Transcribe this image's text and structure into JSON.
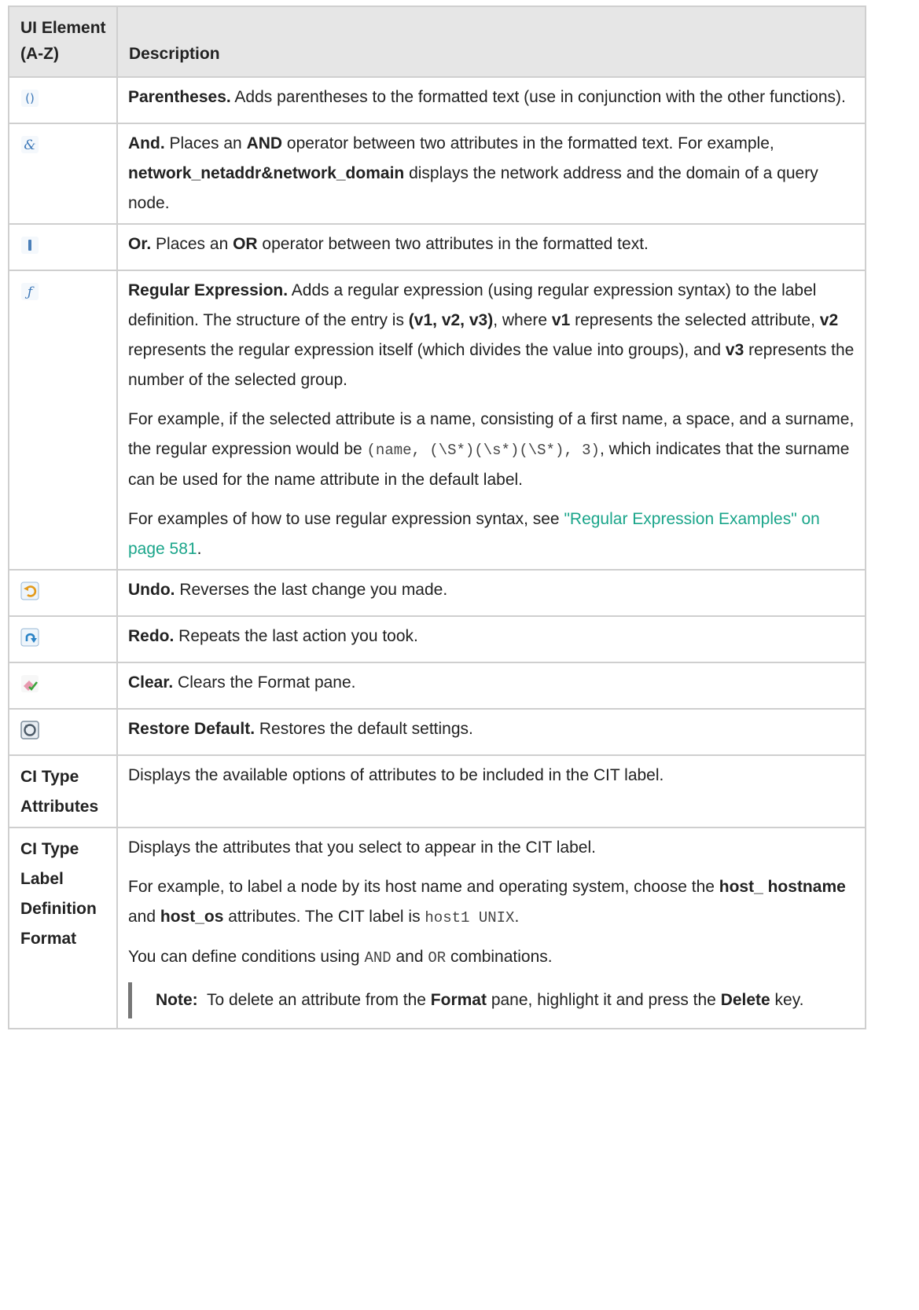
{
  "header": {
    "col1": "UI Element (A-Z)",
    "col2": "Description"
  },
  "rows": {
    "parentheses": {
      "icon": "parentheses-icon",
      "term": "Parentheses.",
      "text": " Adds parentheses to the formatted text (use in conjunction with the other functions)."
    },
    "and": {
      "icon": "ampersand-icon",
      "term": "And.",
      "t1": " Places an ",
      "op": "AND",
      "t2": " operator between two attributes in the formatted text. For example, ",
      "example": "network_netaddr&network_domain",
      "t3": " displays the network address and the domain of a query node."
    },
    "or": {
      "icon": "pipe-icon",
      "term": "Or.",
      "t1": " Places an ",
      "op": "OR",
      "t2": " operator between two attributes in the formatted text."
    },
    "regex": {
      "icon": "function-icon",
      "term": "Regular Expression.",
      "p1a": " Adds a regular expression (using regular expression syntax) to the label definition. The structure of the entry is ",
      "p1b": "(v1, v2, v3)",
      "p1c": ", where ",
      "v1": "v1",
      "p1d": " represents the selected attribute, ",
      "v2": "v2",
      "p1e": " represents the regular expression itself (which divides the value into groups), and ",
      "v3": "v3",
      "p1f": " represents the number of the selected group.",
      "p2a": "For example, if the selected attribute is a name, consisting of a first name, a space, and a surname, the regular expression would be ",
      "p2code": "(name, (\\S*)(\\s*)(\\S*), 3)",
      "p2b": ", which indicates that the surname can be used for the name attribute in the default label.",
      "p3a": "For examples of how to use regular expression syntax, see ",
      "p3link": "\"Regular Expression Examples\" on page 581",
      "p3b": "."
    },
    "undo": {
      "icon": "undo-icon",
      "term": "Undo.",
      "text": " Reverses the last change you made."
    },
    "redo": {
      "icon": "redo-icon",
      "term": "Redo.",
      "text": " Repeats the last action you took."
    },
    "clear": {
      "icon": "eraser-icon",
      "term": "Clear.",
      "text": " Clears the Format pane."
    },
    "restore": {
      "icon": "restore-default-icon",
      "term": "Restore Default.",
      "text": " Restores the default settings."
    },
    "ci_attrs": {
      "name": "CI Type Attributes",
      "text": "Displays the available options of attributes to be included in the CIT label."
    },
    "ci_label": {
      "name": "CI Type Label Definition Format",
      "p1": "Displays the attributes that you select to appear in the CIT label.",
      "p2a": "For example, to label a node by its host name and operating system, choose the ",
      "p2b": "host_ hostname",
      "p2c": " and ",
      "p2d": "host_os",
      "p2e": " attributes. The CIT label is ",
      "p2code": "host1 UNIX",
      "p2f": ".",
      "p3a": "You can define conditions using ",
      "p3and": "AND",
      "p3b": " and ",
      "p3or": "OR",
      "p3c": " combinations.",
      "note_label": "Note:",
      "note_a": "  To delete an attribute from the ",
      "note_b": "Format",
      "note_c": " pane, highlight it and press the ",
      "note_d": "Delete",
      "note_e": " key."
    }
  },
  "colors": {
    "header_bg": "#e6e6e6",
    "border": "#cfcfcf",
    "link": "#1aa58a",
    "note_bar": "#777777"
  }
}
